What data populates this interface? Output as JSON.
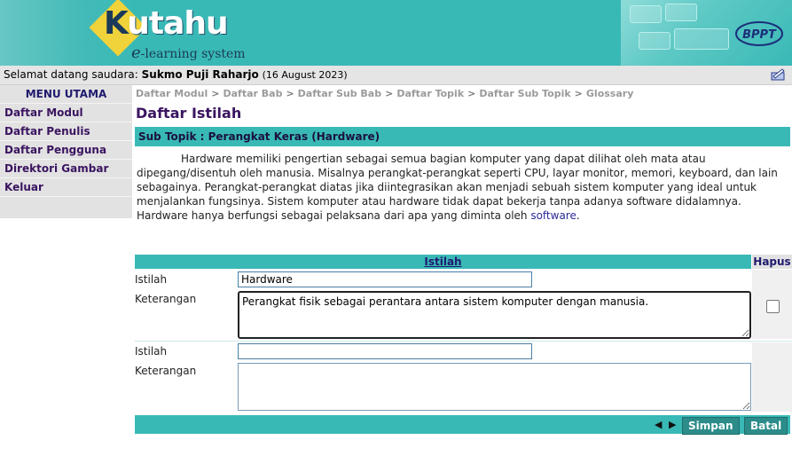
{
  "header": {
    "logo_text": "utahu",
    "logo_k": "K",
    "logo_e": "e",
    "logo_sub": "-learning system",
    "bppt": "BPPT"
  },
  "welcome": {
    "label": "Selamat datang saudara:",
    "name": "Sukmo Puji Raharjo",
    "date": "(16 August 2023)"
  },
  "sidebar": {
    "title": "MENU UTAMA",
    "items": [
      {
        "label": "Daftar Modul"
      },
      {
        "label": "Daftar Penulis"
      },
      {
        "label": "Daftar Pengguna"
      },
      {
        "label": "Direktori Gambar"
      },
      {
        "label": "Keluar"
      }
    ]
  },
  "breadcrumb": [
    "Daftar Modul",
    "Daftar Bab",
    "Daftar Sub Bab",
    "Daftar Topik",
    "Daftar Sub Topik",
    "Glossary"
  ],
  "page_title": "Daftar Istilah",
  "subtopic": "Sub Topik :  Perangkat Keras (Hardware)",
  "description": {
    "text": "Hardware memiliki pengertian sebagai semua bagian komputer yang dapat dilihat oleh mata atau dipegang/disentuh oleh manusia. Misalnya perangkat-perangkat seperti CPU, layar monitor, memori, keyboard, dan lain sebagainya. Perangkat-perangkat diatas jika diintegrasikan akan menjadi sebuah sistem komputer yang ideal untuk menjalankan fungsinya. Sistem komputer atau hardware tidak dapat bekerja tanpa adanya software didalamnya. Hardware hanya berfungsi sebagai pelaksana dari apa yang diminta oleh ",
    "link": "software",
    "end": "."
  },
  "table": {
    "header": "Istilah",
    "hapus_header": "Hapus",
    "rows": [
      {
        "istilah_label": "Istilah",
        "istilah_value": "Hardware",
        "keterangan_label": "Keterangan",
        "keterangan_value": "Perangkat fisik sebagai perantara antara sistem komputer dengan manusia."
      },
      {
        "istilah_label": "Istilah",
        "istilah_value": "",
        "keterangan_label": "Keterangan",
        "keterangan_value": ""
      }
    ]
  },
  "footer": {
    "arrows": "◀ ▶",
    "save_label": "Simpan",
    "cancel_label": "Batal"
  },
  "colors": {
    "accent": "#39b9b6",
    "menu_text": "#3a1460",
    "sidebar_bg": "#e2e2e2"
  }
}
